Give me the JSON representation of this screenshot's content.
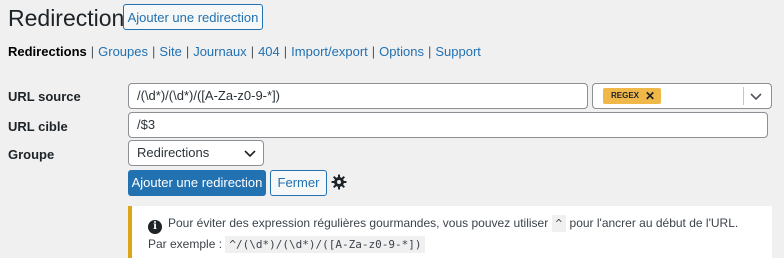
{
  "header": {
    "title": "Redirections",
    "add_button": "Ajouter une redirection"
  },
  "subnav": {
    "items": [
      {
        "label": "Redirections",
        "current": true
      },
      {
        "label": "Groupes",
        "current": false
      },
      {
        "label": "Site",
        "current": false
      },
      {
        "label": "Journaux",
        "current": false
      },
      {
        "label": "404",
        "current": false
      },
      {
        "label": "Import/export",
        "current": false
      },
      {
        "label": "Options",
        "current": false
      },
      {
        "label": "Support",
        "current": false
      }
    ]
  },
  "form": {
    "source_label": "URL source",
    "source_value": "/(\\d*)/(\\d*)/([A-Za-z0-9-*])",
    "regex_tag": "REGEX",
    "target_label": "URL cible",
    "target_value": "/$3",
    "group_label": "Groupe",
    "group_value": "Redirections",
    "submit_label": "Ajouter une redirection",
    "close_label": "Fermer"
  },
  "notice": {
    "text_before": "Pour éviter des expression régulières gourmandes, vous pouvez utiliser",
    "caret": "^",
    "text_after": "pour l'ancrer au début de l'URL. Par exemple :",
    "example": "^/(\\d*)/(\\d*)/([A-Za-z0-9-*])"
  },
  "colors": {
    "primary": "#2271b1",
    "tag": "#f0b849",
    "notice_border": "#dba617"
  }
}
